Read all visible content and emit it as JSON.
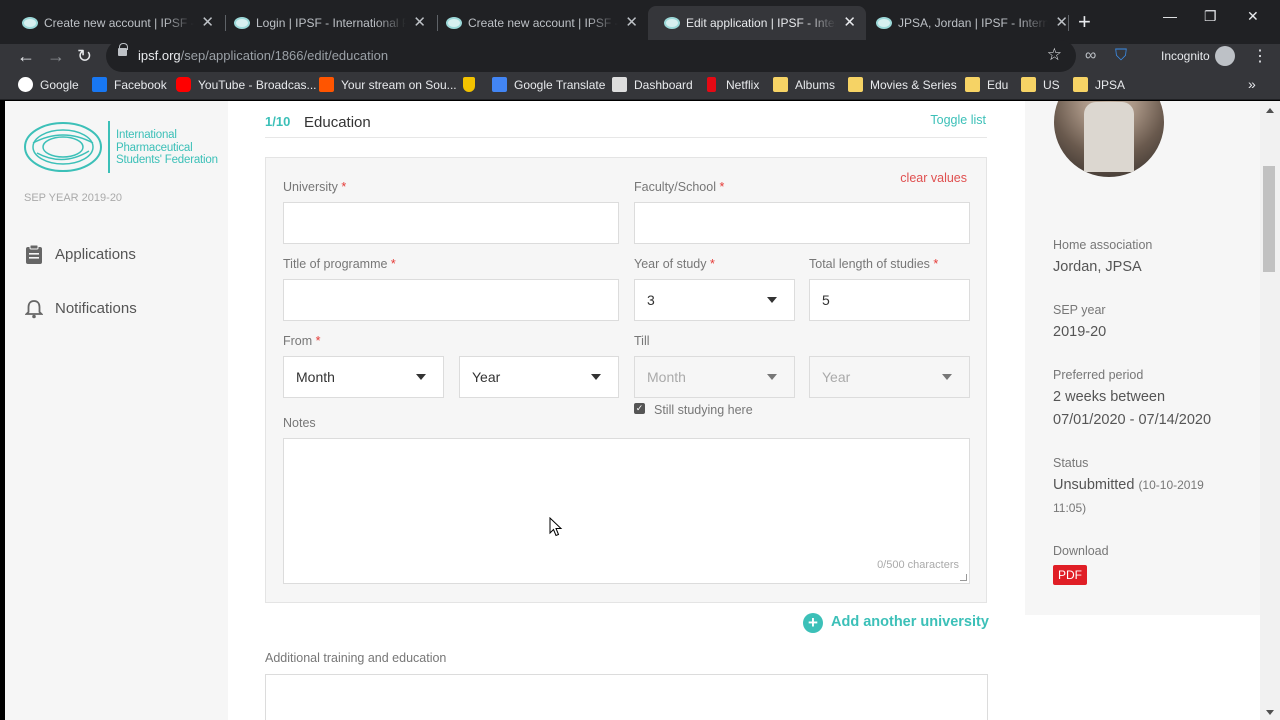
{
  "browser": {
    "tabs": [
      {
        "title": "Create new account | IPSF - International Pharmaceutical Students' Federation",
        "active": false
      },
      {
        "title": "Login | IPSF - International Pharmaceutical Students' Federation",
        "active": false
      },
      {
        "title": "Create new account | IPSF - International Pharmaceutical Students' Federation",
        "active": false
      },
      {
        "title": "Edit application | IPSF - International Pharmaceutical Students' Federation",
        "active": true
      },
      {
        "title": "JPSA, Jordan | IPSF - International Pharmaceutical Students' Federation",
        "active": false
      }
    ],
    "url_host": "ipsf.org",
    "url_path": "/sep/application/1866/edit/education",
    "incognito_label": "Incognito",
    "bookmarks": [
      {
        "label": "Google",
        "icon": "google-icon",
        "color": "#ffffff"
      },
      {
        "label": "Facebook",
        "icon": "facebook-icon",
        "color": "#1877f2"
      },
      {
        "label": "YouTube - Broadcas...",
        "icon": "youtube-icon",
        "color": "#ff0000"
      },
      {
        "label": "Your stream on Sou...",
        "icon": "soundcloud-icon",
        "color": "#ff5500"
      },
      {
        "label": "",
        "icon": "shield-extension-icon",
        "color": "#f2c200"
      },
      {
        "label": "Google Translate",
        "icon": "translate-icon",
        "color": "#4285f4"
      },
      {
        "label": "Dashboard",
        "icon": "dashboard-icon",
        "color": "#dddddd"
      },
      {
        "label": "Netflix",
        "icon": "netflix-icon",
        "color": "#e50914"
      },
      {
        "label": "Albums",
        "icon": "folder-icon",
        "color": "#f6d365"
      },
      {
        "label": "Movies & Series",
        "icon": "folder-icon",
        "color": "#f6d365"
      },
      {
        "label": "Edu",
        "icon": "folder-icon",
        "color": "#f6d365"
      },
      {
        "label": "US",
        "icon": "folder-icon",
        "color": "#f6d365"
      },
      {
        "label": "JPSA",
        "icon": "folder-icon",
        "color": "#f6d365"
      }
    ]
  },
  "sidebar": {
    "logo_lines": [
      "International",
      "Pharmaceutical",
      "Students' Federation"
    ],
    "sep_year": "SEP YEAR 2019-20",
    "items": [
      {
        "label": "Applications",
        "icon": "clipboard-icon"
      },
      {
        "label": "Notifications",
        "icon": "bell-icon"
      }
    ]
  },
  "main": {
    "step": "1/10",
    "title": "Education",
    "toggle_list": "Toggle list",
    "clear_values": "clear values",
    "fields": {
      "university": {
        "label": "University",
        "value": ""
      },
      "faculty": {
        "label": "Faculty/School",
        "value": ""
      },
      "programme": {
        "label": "Title of programme",
        "value": ""
      },
      "year_of_study": {
        "label": "Year of study",
        "value": "3"
      },
      "total_length": {
        "label": "Total length of studies",
        "value": "5"
      },
      "from": {
        "label": "From",
        "month": "Month",
        "year": "Year"
      },
      "till": {
        "label": "Till",
        "month": "Month",
        "year": "Year"
      },
      "still_studying": {
        "label": "Still studying here",
        "checked": true
      },
      "notes": {
        "label": "Notes",
        "counter": "0/500 characters"
      }
    },
    "add_university": "Add another university",
    "additional_label": "Additional training and education"
  },
  "summary": {
    "home_association_label": "Home association",
    "home_association": "Jordan, JPSA",
    "sep_year_label": "SEP year",
    "sep_year": "2019-20",
    "preferred_period_label": "Preferred period",
    "preferred_period_line1": "2 weeks between",
    "preferred_period_line2": "07/01/2020 - 07/14/2020",
    "status_label": "Status",
    "status": "Unsubmitted",
    "status_date_line1": "(10-10-2019",
    "status_date_line2": "11:05)",
    "download_label": "Download",
    "pdf_label": "PDF"
  },
  "colors": {
    "accent": "#3cc0b8",
    "required": "#e53935",
    "pdf": "#e01e26"
  }
}
